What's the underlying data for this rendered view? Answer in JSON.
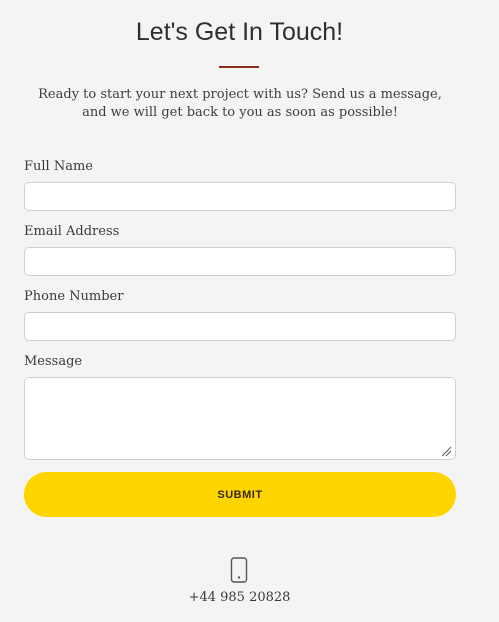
{
  "header": {
    "title": "Let's Get In Touch!",
    "intro": "Ready to start your next project with us? Send us a message, and we will get back to you as soon as possible!"
  },
  "form": {
    "full_name_label": "Full Name",
    "full_name_value": "",
    "email_label": "Email Address",
    "email_value": "",
    "phone_label": "Phone Number",
    "phone_value": "",
    "message_label": "Message",
    "message_value": "",
    "submit_label": "SUBMIT"
  },
  "contact": {
    "phone_icon": "mobile-phone-icon",
    "phone_number": "+44 985 20828"
  },
  "colors": {
    "background": "#f4f4f4",
    "accent_divider": "#8b2d1b",
    "submit_button": "#ffd500"
  }
}
